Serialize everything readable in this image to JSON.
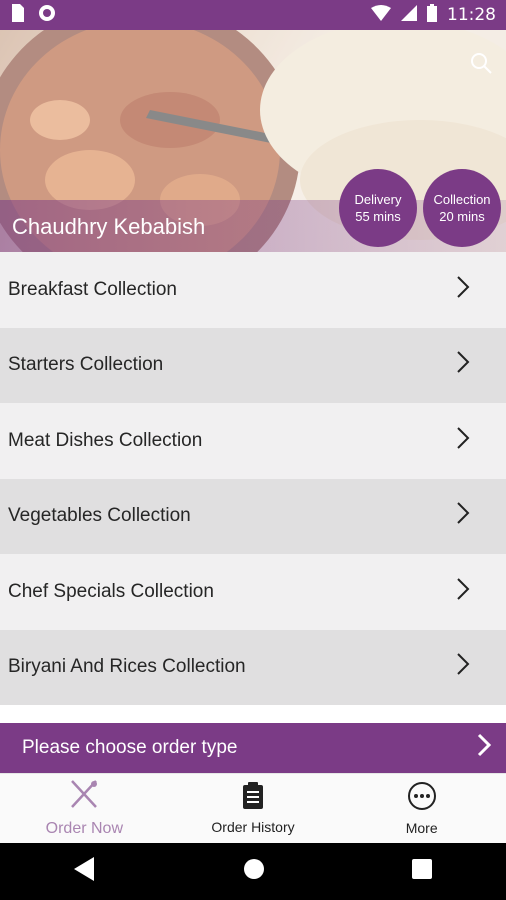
{
  "status_bar": {
    "time": "11:28",
    "icons": [
      "sd-card-icon",
      "circle-record-icon",
      "wifi-icon",
      "signal-icon",
      "battery-icon"
    ],
    "bg_color": "#7b3b86"
  },
  "hero": {
    "restaurant_name": "Chaudhry Kebabish",
    "delivery": {
      "label": "Delivery",
      "time": "55 mins"
    },
    "collection": {
      "label": "Collection",
      "time": "20 mins"
    }
  },
  "menu": {
    "items": [
      {
        "label": "Breakfast Collection"
      },
      {
        "label": "Starters Collection"
      },
      {
        "label": "Meat Dishes Collection"
      },
      {
        "label": "Vegetables Collection"
      },
      {
        "label": "Chef Specials Collection"
      },
      {
        "label": "Biryani And Rices Collection"
      }
    ]
  },
  "order_bar": {
    "label": "Please choose order type"
  },
  "bottom_nav": {
    "items": [
      {
        "label": "Order Now",
        "icon": "fork-knife-icon",
        "active": true
      },
      {
        "label": "Order History",
        "icon": "clipboard-icon",
        "active": false
      },
      {
        "label": "More",
        "icon": "more-dots-icon",
        "active": false
      }
    ]
  },
  "colors": {
    "accent": "#7b3b86",
    "active_nav": "#a985b1"
  }
}
